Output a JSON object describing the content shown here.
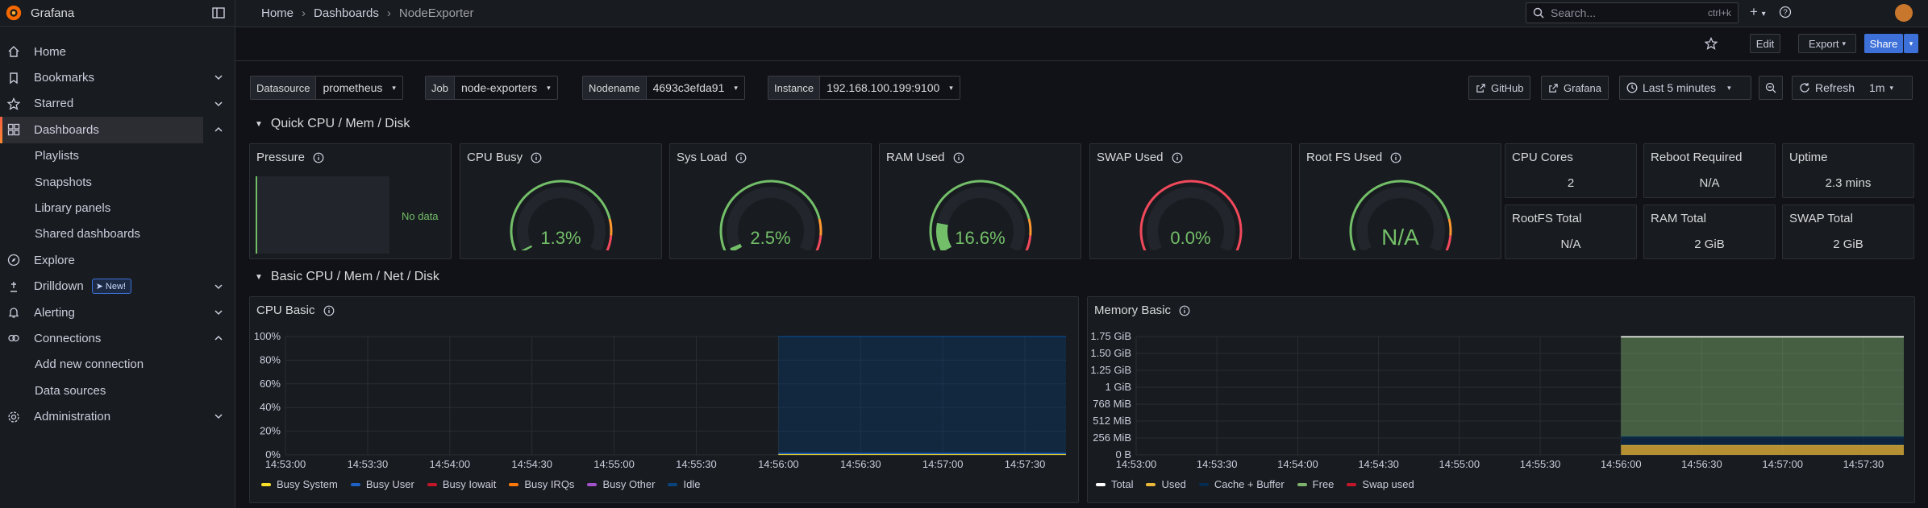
{
  "app": {
    "name": "Grafana"
  },
  "sidebar": {
    "items": [
      {
        "label": "Home",
        "icon": "home-icon"
      },
      {
        "label": "Bookmarks",
        "icon": "bookmark-icon"
      },
      {
        "label": "Starred",
        "icon": "star-icon"
      },
      {
        "label": "Dashboards",
        "icon": "dashboards-icon"
      },
      {
        "label": "Playlists"
      },
      {
        "label": "Snapshots"
      },
      {
        "label": "Library panels"
      },
      {
        "label": "Shared dashboards"
      },
      {
        "label": "Explore",
        "icon": "compass-icon"
      },
      {
        "label": "Drilldown",
        "icon": "drilldown-icon",
        "badge": "New!"
      },
      {
        "label": "Alerting",
        "icon": "bell-icon"
      },
      {
        "label": "Connections",
        "icon": "connections-icon"
      },
      {
        "label": "Add new connection"
      },
      {
        "label": "Data sources"
      },
      {
        "label": "Administration",
        "icon": "gear-icon"
      }
    ]
  },
  "topbar": {
    "breadcrumbs": [
      "Home",
      "Dashboards",
      "NodeExporter"
    ],
    "search_placeholder": "Search...",
    "search_shortcut": "ctrl+k"
  },
  "toolbar": {
    "edit": "Edit",
    "export": "Export",
    "share": "Share"
  },
  "variables": [
    {
      "label": "Datasource",
      "value": "prometheus"
    },
    {
      "label": "Job",
      "value": "node-exporters"
    },
    {
      "label": "Nodename",
      "value": "4693c3efda91"
    },
    {
      "label": "Instance",
      "value": "192.168.100.199:9100"
    }
  ],
  "links": {
    "github": "GitHub",
    "grafana": "Grafana"
  },
  "time": {
    "range": "Last 5 minutes",
    "refresh": "Refresh",
    "interval": "1m"
  },
  "rows": {
    "quick": "Quick CPU / Mem / Disk",
    "basic": "Basic CPU / Mem / Net / Disk"
  },
  "panels": {
    "pressure": {
      "title": "Pressure",
      "nodata": "No data"
    },
    "gauges": [
      {
        "title": "CPU Busy",
        "value": "1.3%",
        "fraction": 0.013
      },
      {
        "title": "Sys Load",
        "value": "2.5%",
        "fraction": 0.025
      },
      {
        "title": "RAM Used",
        "value": "16.6%",
        "fraction": 0.166
      },
      {
        "title": "SWAP Used",
        "value": "0.0%",
        "fraction": 0.0
      },
      {
        "title": "Root FS Used",
        "value": "N/A",
        "fraction": 0.0
      }
    ],
    "stats": [
      {
        "title": "CPU Cores",
        "value": "2"
      },
      {
        "title": "Reboot Required",
        "value": "N/A"
      },
      {
        "title": "Uptime",
        "value": "2.3 mins"
      },
      {
        "title": "RootFS Total",
        "value": "N/A"
      },
      {
        "title": "RAM Total",
        "value": "2 GiB"
      },
      {
        "title": "SWAP Total",
        "value": "2 GiB"
      }
    ]
  },
  "colors": {
    "green": "#73bf69",
    "red": "#f2495c",
    "orange": "#ff9830",
    "blue": "#5794f2",
    "accent": "#3d71d9"
  },
  "chart_data": [
    {
      "type": "area",
      "title": "CPU Basic",
      "x": [
        "14:53:00",
        "14:53:30",
        "14:54:00",
        "14:54:30",
        "14:55:00",
        "14:55:30",
        "14:56:00",
        "14:56:30",
        "14:57:00",
        "14:57:30"
      ],
      "yticks": [
        "100%",
        "80%",
        "60%",
        "40%",
        "20%",
        "0%"
      ],
      "ylim": [
        0,
        100
      ],
      "data_start": "14:56:00",
      "data_end": "14:57:45",
      "series": [
        {
          "name": "Busy System",
          "color": "#fade2a",
          "values": [
            0.6,
            0.6,
            0.6,
            0.6
          ]
        },
        {
          "name": "Busy User",
          "color": "#1f60c4",
          "values": [
            0.7,
            0.7,
            0.7,
            0.7
          ]
        },
        {
          "name": "Busy Iowait",
          "color": "#c4162a",
          "values": [
            0,
            0,
            0,
            0
          ]
        },
        {
          "name": "Busy IRQs",
          "color": "#ff780a",
          "values": [
            0,
            0,
            0,
            0
          ]
        },
        {
          "name": "Busy Other",
          "color": "#a352cc",
          "values": [
            0,
            0,
            0,
            0
          ]
        },
        {
          "name": "Idle",
          "color": "#0a437c",
          "values": [
            98.7,
            98.7,
            98.7,
            98.7
          ]
        }
      ]
    },
    {
      "type": "area",
      "title": "Memory Basic",
      "x": [
        "14:53:00",
        "14:53:30",
        "14:54:00",
        "14:54:30",
        "14:55:00",
        "14:55:30",
        "14:56:00",
        "14:56:30",
        "14:57:00",
        "14:57:30"
      ],
      "yticks": [
        "1.75 GiB",
        "1.50 GiB",
        "1.25 GiB",
        "1 GiB",
        "768 MiB",
        "512 MiB",
        "256 MiB",
        "0 B"
      ],
      "ylim": [
        0,
        1.875
      ],
      "data_start": "14:56:00",
      "data_end": "14:57:45",
      "series": [
        {
          "name": "Total",
          "color": "#ffffff",
          "values": [
            1.87,
            1.87,
            1.87,
            1.87
          ]
        },
        {
          "name": "Used",
          "color": "#eab839",
          "values": [
            0.15,
            0.15,
            0.15,
            0.15
          ]
        },
        {
          "name": "Cache + Buffer",
          "color": "#052b51",
          "values": [
            0.14,
            0.14,
            0.14,
            0.14
          ]
        },
        {
          "name": "Free",
          "color": "#7eb26d",
          "values": [
            1.58,
            1.58,
            1.58,
            1.58
          ]
        },
        {
          "name": "Swap used",
          "color": "#c4162a",
          "values": [
            0,
            0,
            0,
            0
          ]
        }
      ]
    }
  ]
}
